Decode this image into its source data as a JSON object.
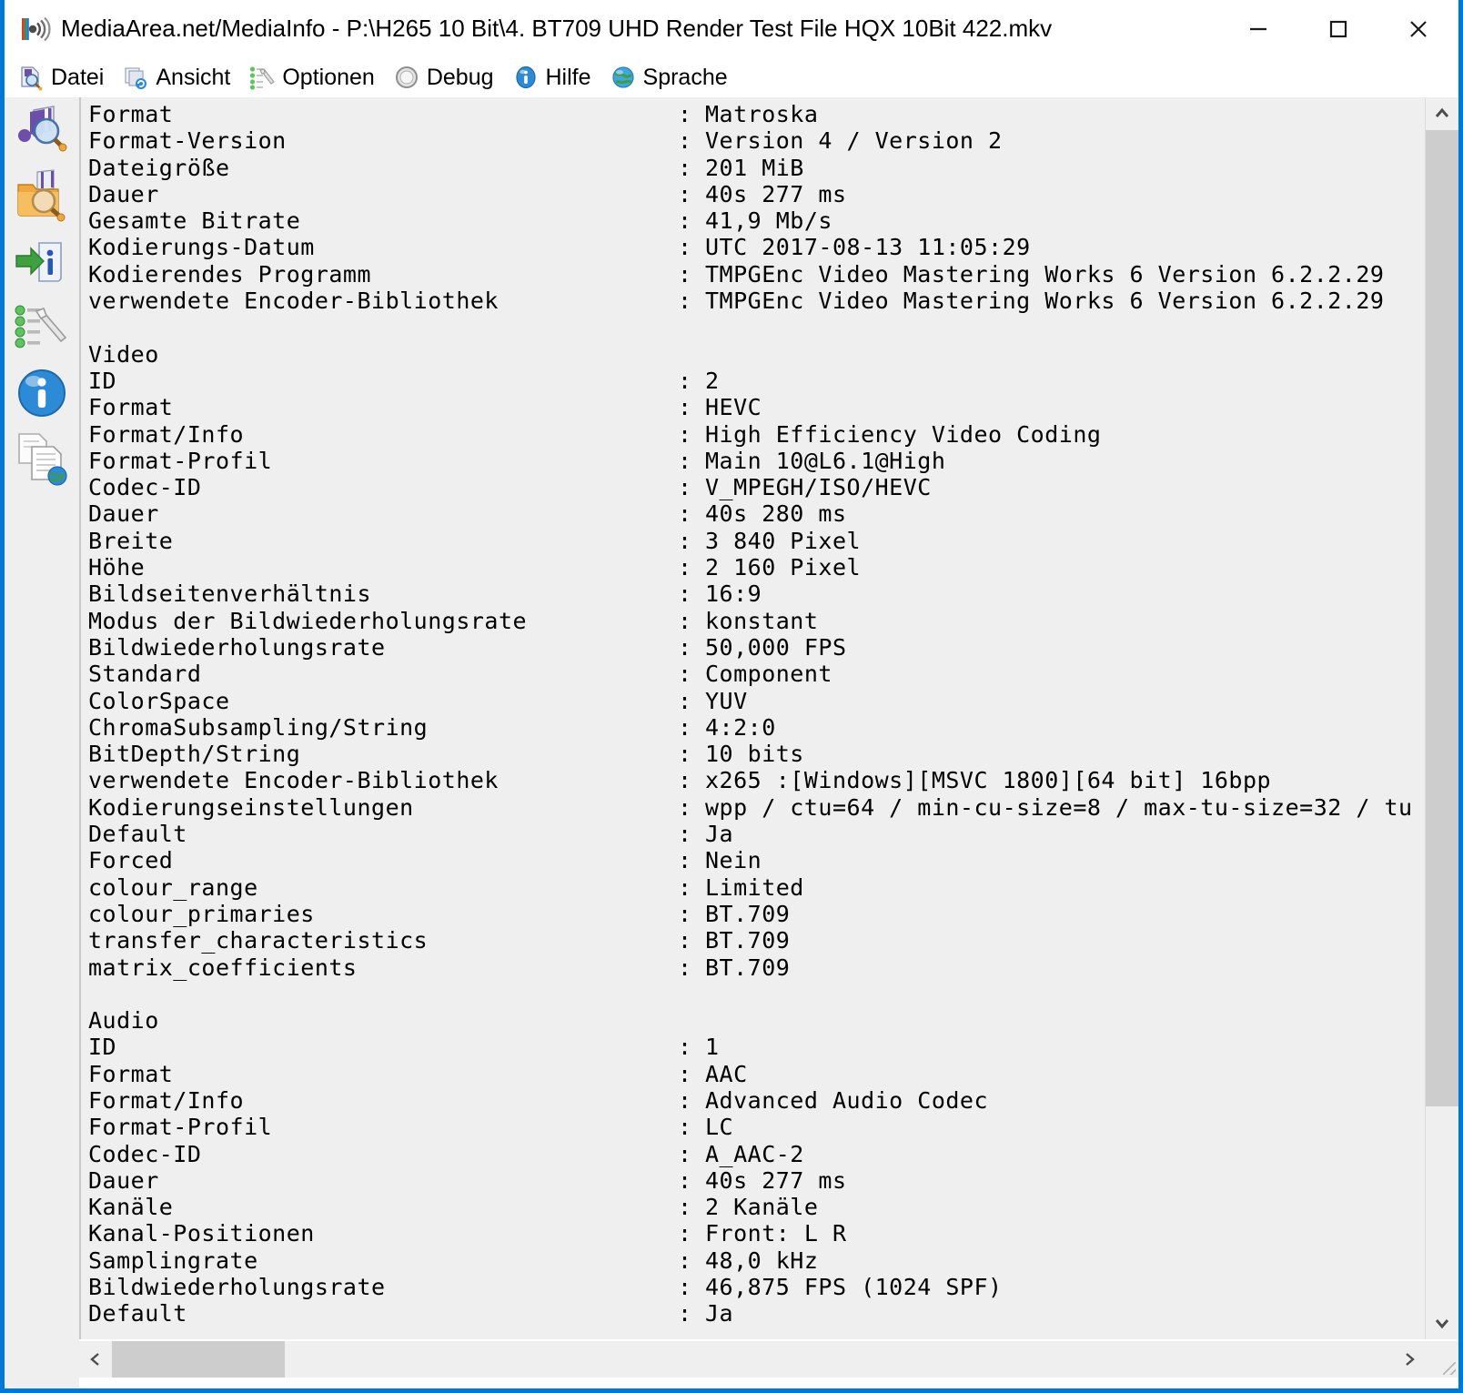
{
  "window": {
    "title": "MediaArea.net/MediaInfo - P:\\H265 10 Bit\\4. BT709 UHD Render Test File HQX 10Bit 422.mkv",
    "app_icon": "mediainfo-logo-icon",
    "accent_color": "#0078d7",
    "background_color": "#efefef",
    "controls": {
      "minimize": "minimize-icon",
      "maximize": "maximize-icon",
      "close": "close-icon"
    }
  },
  "menubar": {
    "items": [
      {
        "label": "Datei",
        "icon": "file-magnifier-icon"
      },
      {
        "label": "Ansicht",
        "icon": "view-refresh-icon"
      },
      {
        "label": "Optionen",
        "icon": "options-wrench-icon"
      },
      {
        "label": "Debug",
        "icon": "compass-icon"
      },
      {
        "label": "Hilfe",
        "icon": "info-circle-icon"
      },
      {
        "label": "Sprache",
        "icon": "globe-icon"
      }
    ]
  },
  "sidebar": {
    "items": [
      {
        "name": "audio-inspect-icon",
        "title": "Einfach"
      },
      {
        "name": "folder-inspect-icon",
        "title": "Ordner"
      },
      {
        "name": "export-info-icon",
        "title": "Export"
      },
      {
        "name": "tree-wrench-icon",
        "title": "Baum"
      },
      {
        "name": "info-blue-icon",
        "title": "Info"
      },
      {
        "name": "sheet-globe-icon",
        "title": "HTML"
      }
    ]
  },
  "info": {
    "lines": [
      {
        "type": "kv",
        "label": "Format",
        "value": "Matroska"
      },
      {
        "type": "kv",
        "label": "Format-Version",
        "value": "Version 4 / Version 2"
      },
      {
        "type": "kv",
        "label": "Dateigröße",
        "value": "201 MiB"
      },
      {
        "type": "kv",
        "label": "Dauer",
        "value": "40s 277 ms"
      },
      {
        "type": "kv",
        "label": "Gesamte Bitrate",
        "value": "41,9 Mb/s"
      },
      {
        "type": "kv",
        "label": "Kodierungs-Datum",
        "value": "UTC 2017-08-13 11:05:29"
      },
      {
        "type": "kv",
        "label": "Kodierendes Programm",
        "value": "TMPGEnc Video Mastering Works 6 Version 6.2.2.29"
      },
      {
        "type": "kv",
        "label": "verwendete Encoder-Bibliothek",
        "value": "TMPGEnc Video Mastering Works 6 Version 6.2.2.29"
      },
      {
        "type": "blank",
        "label": "",
        "value": ""
      },
      {
        "type": "section",
        "label": "Video",
        "value": ""
      },
      {
        "type": "kv",
        "label": "ID",
        "value": "2"
      },
      {
        "type": "kv",
        "label": "Format",
        "value": "HEVC"
      },
      {
        "type": "kv",
        "label": "Format/Info",
        "value": "High Efficiency Video Coding"
      },
      {
        "type": "kv",
        "label": "Format-Profil",
        "value": "Main 10@L6.1@High"
      },
      {
        "type": "kv",
        "label": "Codec-ID",
        "value": "V_MPEGH/ISO/HEVC"
      },
      {
        "type": "kv",
        "label": "Dauer",
        "value": "40s 280 ms"
      },
      {
        "type": "kv",
        "label": "Breite",
        "value": "3 840 Pixel"
      },
      {
        "type": "kv",
        "label": "Höhe",
        "value": "2 160 Pixel"
      },
      {
        "type": "kv",
        "label": "Bildseitenverhältnis",
        "value": "16:9"
      },
      {
        "type": "kv",
        "label": "Modus der Bildwiederholungsrate",
        "value": "konstant"
      },
      {
        "type": "kv",
        "label": "Bildwiederholungsrate",
        "value": "50,000 FPS"
      },
      {
        "type": "kv",
        "label": "Standard",
        "value": "Component"
      },
      {
        "type": "kv",
        "label": "ColorSpace",
        "value": "YUV"
      },
      {
        "type": "kv",
        "label": "ChromaSubsampling/String",
        "value": "4:2:0"
      },
      {
        "type": "kv",
        "label": "BitDepth/String",
        "value": "10 bits"
      },
      {
        "type": "kv",
        "label": "verwendete Encoder-Bibliothek",
        "value": "x265 :[Windows][MSVC 1800][64 bit] 16bpp"
      },
      {
        "type": "kv",
        "label": "Kodierungseinstellungen",
        "value": "wpp / ctu=64 / min-cu-size=8 / max-tu-size=32 / tu"
      },
      {
        "type": "kv",
        "label": "Default",
        "value": "Ja"
      },
      {
        "type": "kv",
        "label": "Forced",
        "value": "Nein"
      },
      {
        "type": "kv",
        "label": "colour_range",
        "value": "Limited"
      },
      {
        "type": "kv",
        "label": "colour_primaries",
        "value": "BT.709"
      },
      {
        "type": "kv",
        "label": "transfer_characteristics",
        "value": "BT.709"
      },
      {
        "type": "kv",
        "label": "matrix_coefficients",
        "value": "BT.709"
      },
      {
        "type": "blank",
        "label": "",
        "value": ""
      },
      {
        "type": "section",
        "label": "Audio",
        "value": ""
      },
      {
        "type": "kv",
        "label": "ID",
        "value": "1"
      },
      {
        "type": "kv",
        "label": "Format",
        "value": "AAC"
      },
      {
        "type": "kv",
        "label": "Format/Info",
        "value": "Advanced Audio Codec"
      },
      {
        "type": "kv",
        "label": "Format-Profil",
        "value": "LC"
      },
      {
        "type": "kv",
        "label": "Codec-ID",
        "value": "A_AAC-2"
      },
      {
        "type": "kv",
        "label": "Dauer",
        "value": "40s 277 ms"
      },
      {
        "type": "kv",
        "label": "Kanäle",
        "value": "2 Kanäle"
      },
      {
        "type": "kv",
        "label": "Kanal-Positionen",
        "value": "Front: L R"
      },
      {
        "type": "kv",
        "label": "Samplingrate",
        "value": "48,0 kHz"
      },
      {
        "type": "kv",
        "label": "Bildwiederholungsrate",
        "value": "46,875 FPS (1024 SPF)"
      },
      {
        "type": "kv",
        "label": "Default",
        "value": "Ja"
      }
    ],
    "separator": ":"
  },
  "scrollbars": {
    "vertical": {
      "up_arrow": "chevron-up-icon",
      "down_arrow": "chevron-down-icon"
    },
    "horizontal": {
      "left_arrow": "chevron-left-icon",
      "right_arrow": "chevron-right-icon"
    }
  }
}
